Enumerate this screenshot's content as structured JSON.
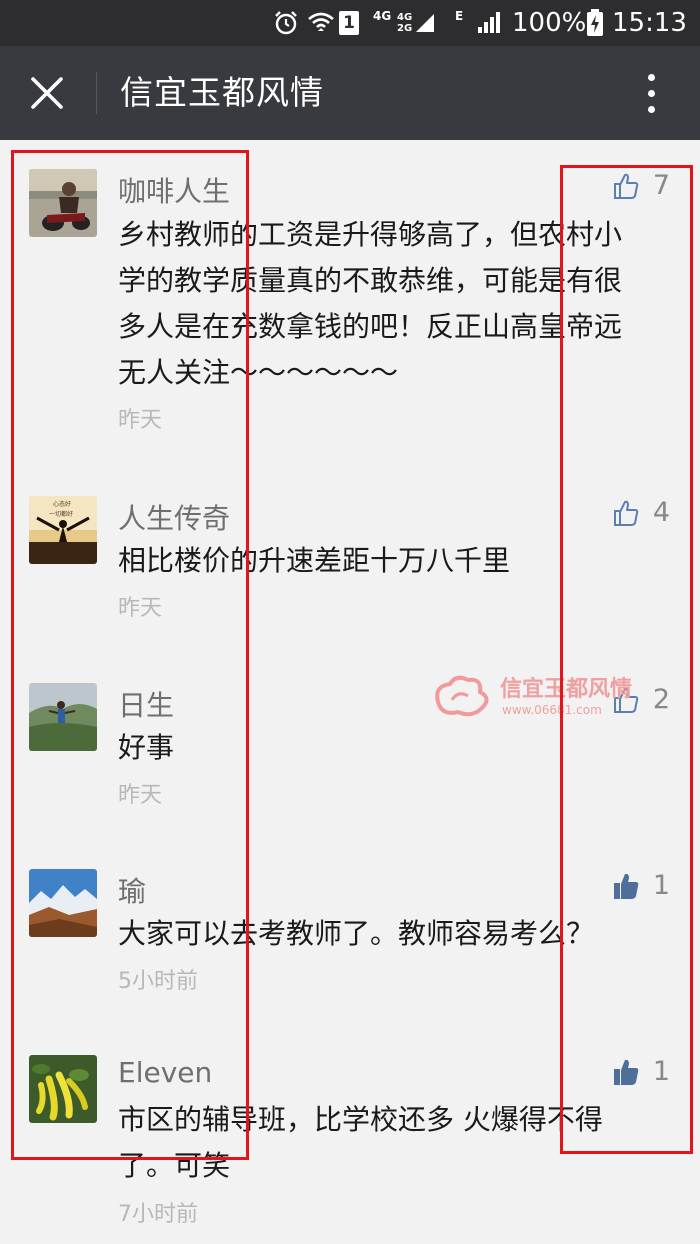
{
  "status_bar": {
    "sim_badge": "1",
    "network_4g": "4G",
    "network_4g2g_top": "4G",
    "network_4g2g_bottom": "2G",
    "network_e": "E",
    "battery": "100%",
    "time": "15:13"
  },
  "header": {
    "title": "信宜玉都风情"
  },
  "comments": [
    {
      "username": "咖啡人生",
      "lines": [
        "乡村教师的工资是升得够高了，但农村小",
        "学的教学质量真的不敢恭维，可能是有很",
        "多人是在充数拿钱的吧！反正山高皇帝远",
        "无人关注～～～～～～"
      ],
      "time": "昨天",
      "likes": "7",
      "liked": false
    },
    {
      "username": "人生传奇",
      "lines": [
        "相比楼价的升速差距十万八千里"
      ],
      "time": "昨天",
      "likes": "4",
      "liked": false
    },
    {
      "username": "日生",
      "lines": [
        "好事"
      ],
      "time": "昨天",
      "likes": "2",
      "liked": false
    },
    {
      "username": "瑜",
      "lines": [
        "大家可以去考教师了。教师容易考么？"
      ],
      "time": "5小时前",
      "likes": "1",
      "liked": true
    },
    {
      "username": "Eleven",
      "lines": [
        "市区的辅导班，比学校还多 火爆得不得",
        "了。可笑"
      ],
      "time": "7小时前",
      "likes": "1",
      "liked": true
    }
  ],
  "watermark": {
    "brand": "信宜玉都风情",
    "url": "www.06681.com"
  },
  "colors": {
    "status_bar_bg": "#2d2d2f",
    "nav_bar_bg": "#393a3f",
    "content_bg": "#f2f2f2",
    "like_outline": "#5b7fb0",
    "like_filled": "#4f6f9b",
    "annotation_red": "#e5141b"
  }
}
